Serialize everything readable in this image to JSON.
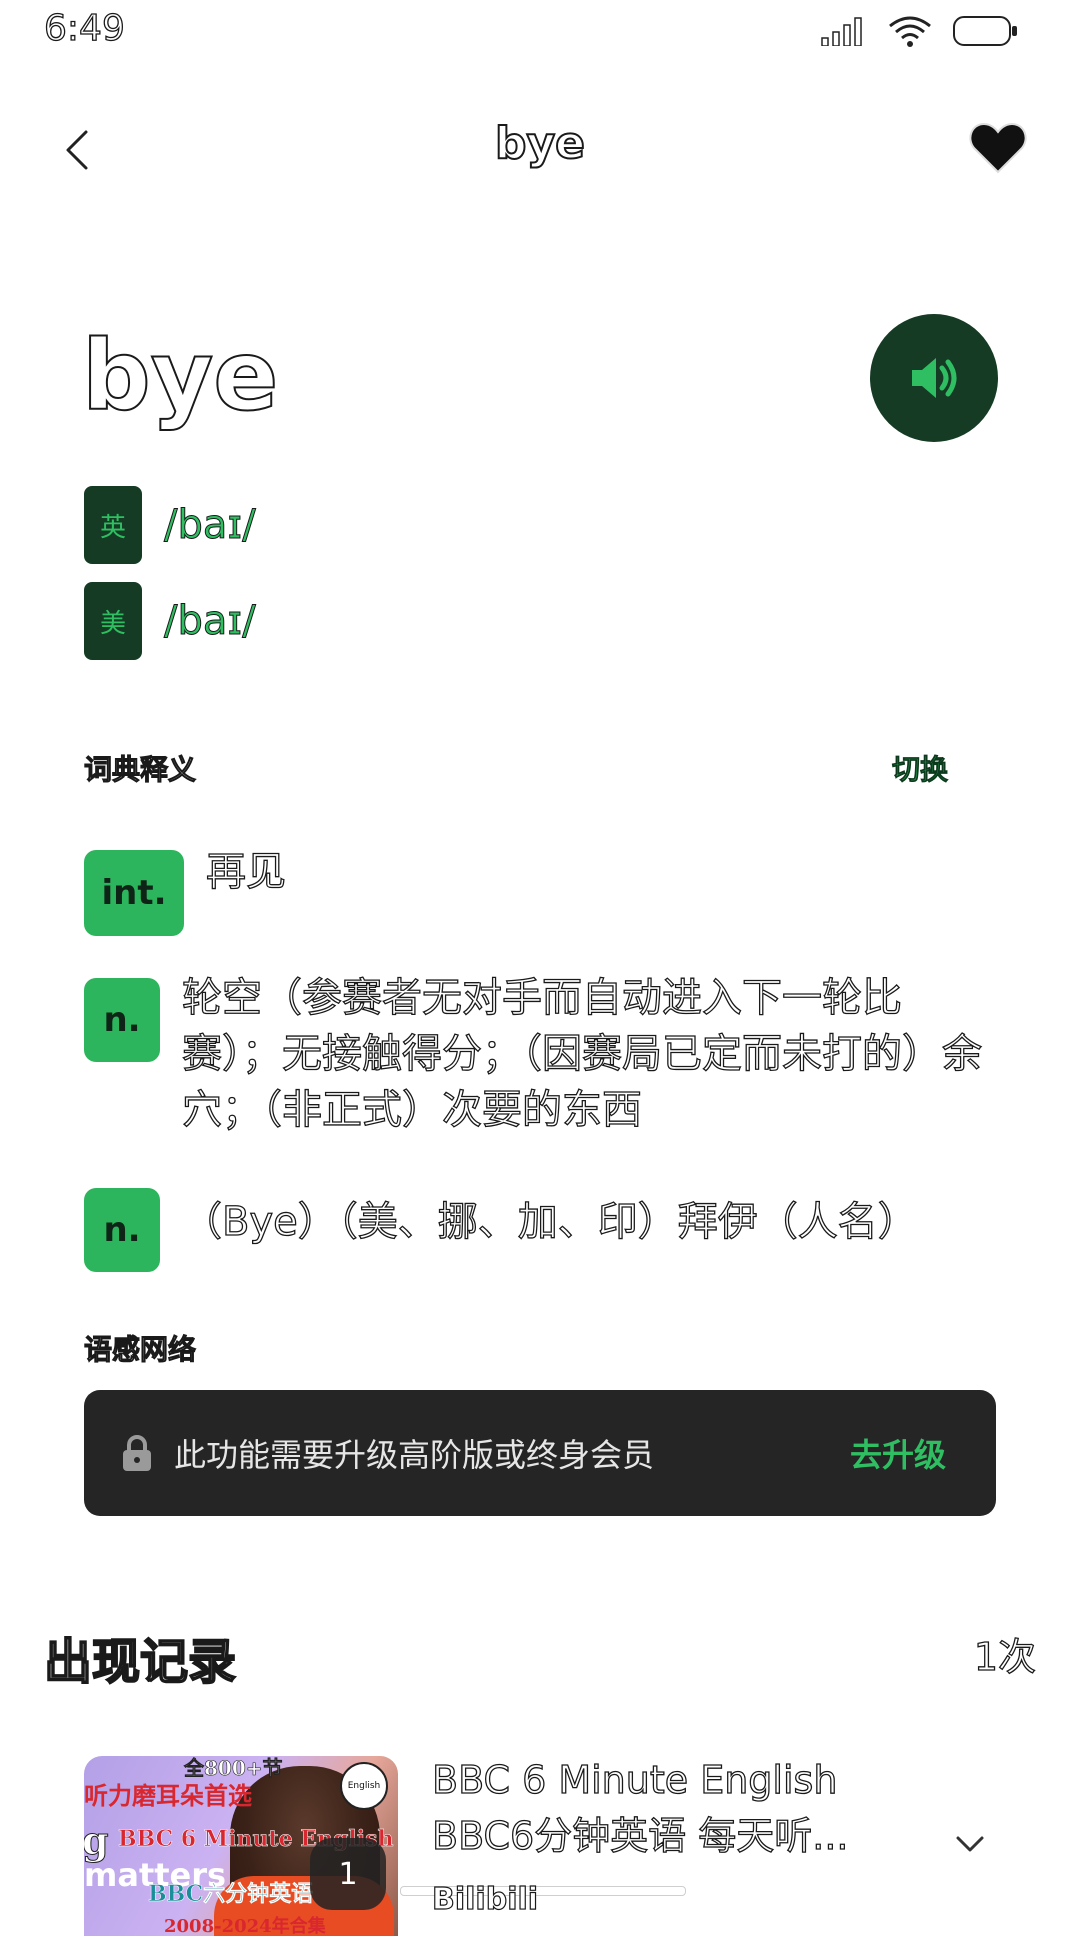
{
  "status_bar": {
    "time": "6:49",
    "icons": [
      "signal-icon",
      "wifi-icon",
      "battery-icon"
    ]
  },
  "header": {
    "title": "bye",
    "back_icon": "chevron-left-icon",
    "favorite_icon": "heart-icon"
  },
  "word": {
    "text": "bye",
    "speaker_icon": "speaker-icon",
    "accent_color": "#2fbf62",
    "dark_green": "#163b24",
    "pronunciations": [
      {
        "region": "英",
        "ipa": "/baɪ/"
      },
      {
        "region": "美",
        "ipa": "/baɪ/"
      }
    ]
  },
  "dictionary": {
    "label": "词典释义",
    "switch_label": "切换",
    "definitions": [
      {
        "pos": "int.",
        "text": "再见"
      },
      {
        "pos": "n.",
        "text": "轮空（参赛者无对手而自动进入下一轮比赛）；无接触得分；（因赛局已定而未打的）余穴；（非正式）次要的东西"
      },
      {
        "pos": "n.",
        "text": "（Bye）（美、挪、加、印）拜伊（人名）"
      }
    ]
  },
  "network": {
    "label": "语感网络",
    "lock_icon": "lock-icon",
    "locked_text": "此功能需要升级高阶版或终身会员",
    "upgrade_label": "去升级"
  },
  "records": {
    "title": "出现记录",
    "count": "1次",
    "item": {
      "title": "BBC 6 Minute English BBC6分钟英语 每天听...",
      "source": "Bilibili",
      "page_number": "1",
      "thumb_lines": [
        "全800+节",
        "听力磨耳朵首选",
        "BBC 6 Minute English",
        "BBC六分钟英语",
        "2008-2024年合集"
      ],
      "thumb_side_text": [
        "g",
        "matters"
      ]
    }
  }
}
